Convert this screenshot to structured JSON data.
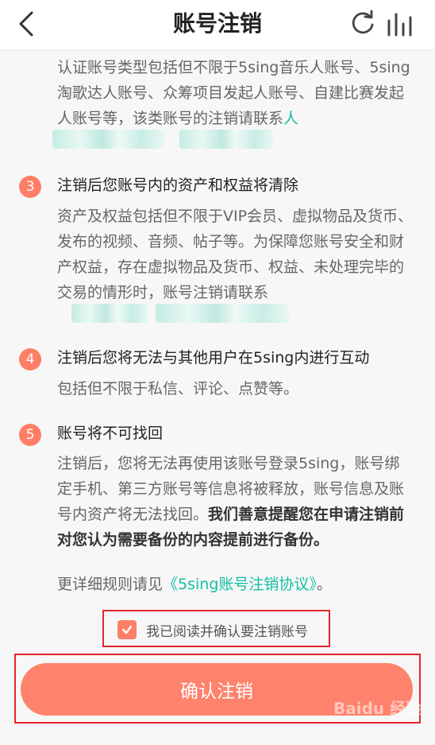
{
  "header": {
    "title": "账号注销"
  },
  "section2": {
    "desc_plain": "认证账号类型包括但不限于5sing音乐人账号、5sing淘歌达人账号、众筹项目发起人账号、自建比赛发起人账号等，该类账号的注销请联系",
    "desc_link": "人"
  },
  "section3": {
    "number": "3",
    "title": "注销后您账号内的资产和权益将清除",
    "desc": "资产及权益包括但不限于VIP会员、虚拟物品及货币、发布的视频、音频、帖子等。为保障您账号安全和财产权益，存在虚拟物品及货币、权益、未处理完毕的交易的情形时，账号注销请联系"
  },
  "section4": {
    "number": "4",
    "title": "注销后您将无法与其他用户在5sing内进行互动",
    "desc": "包括但不限于私信、评论、点赞等。"
  },
  "section5": {
    "number": "5",
    "title": "账号将不可找回",
    "desc_plain": "注销后，您将无法再使用该账号登录5sing，账号绑定手机、第三方账号等信息将被释放，账号信息及账号内资产将无法找回。",
    "desc_bold": "我们善意提醒您在申请注销前对您认为需要备份的内容提前进行备份。",
    "rules_prefix": "更详细规则请见",
    "rules_link": "《5sing账号注销协议》",
    "rules_suffix": "。"
  },
  "agreement": {
    "label": "我已阅读并确认要注销账号",
    "checked": true
  },
  "confirm_button": {
    "label": "确认注销"
  },
  "watermark": {
    "text": "Baidu 经验"
  },
  "colors": {
    "accent": "#ff7e66",
    "link": "#13bfa4",
    "highlight_box": "#e5262a"
  }
}
